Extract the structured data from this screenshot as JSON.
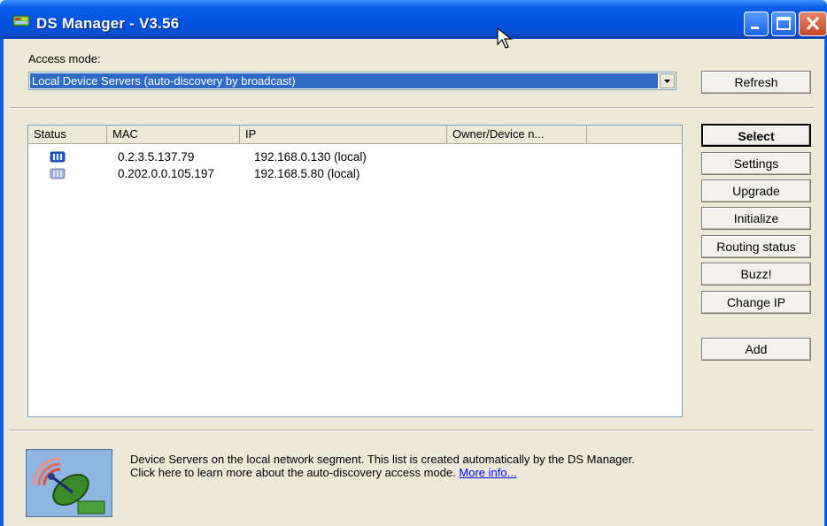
{
  "window": {
    "title": "DS Manager - V3.56",
    "controls": [
      "minimize-icon",
      "maximize-icon",
      "close-icon"
    ]
  },
  "access_mode": {
    "label": "Access mode:",
    "selected": "Local Device Servers (auto-discovery by broadcast)"
  },
  "buttons": {
    "refresh": "Refresh",
    "select": "Select",
    "settings": "Settings",
    "upgrade": "Upgrade",
    "initialize": "Initialize",
    "routing_status": "Routing status",
    "buzz": "Buzz!",
    "change_ip": "Change IP",
    "add": "Add"
  },
  "device_list": {
    "columns": [
      "Status",
      "MAC",
      "IP",
      "Owner/Device n..."
    ],
    "rows": [
      {
        "status_icon": "device-online-icon",
        "mac": "0.2.3.5.137.79",
        "ip": "192.168.0.130 (local)",
        "owner": ""
      },
      {
        "status_icon": "device-offline-icon",
        "mac": "0.202.0.0.105.197",
        "ip": "192.168.5.80 (local)",
        "owner": ""
      }
    ]
  },
  "info_panel": {
    "icon": "satellite-dish-icon",
    "line1": "Device Servers on the local network segment. This list is created automatically by the DS Manager.",
    "line2": "Click here to learn more about the auto-discovery access mode.",
    "link": "More info..."
  },
  "colors": {
    "titlebar": "#0053e1",
    "selection": "#316ac5",
    "window_bg": "#ece9d8",
    "link": "#0000ff"
  }
}
